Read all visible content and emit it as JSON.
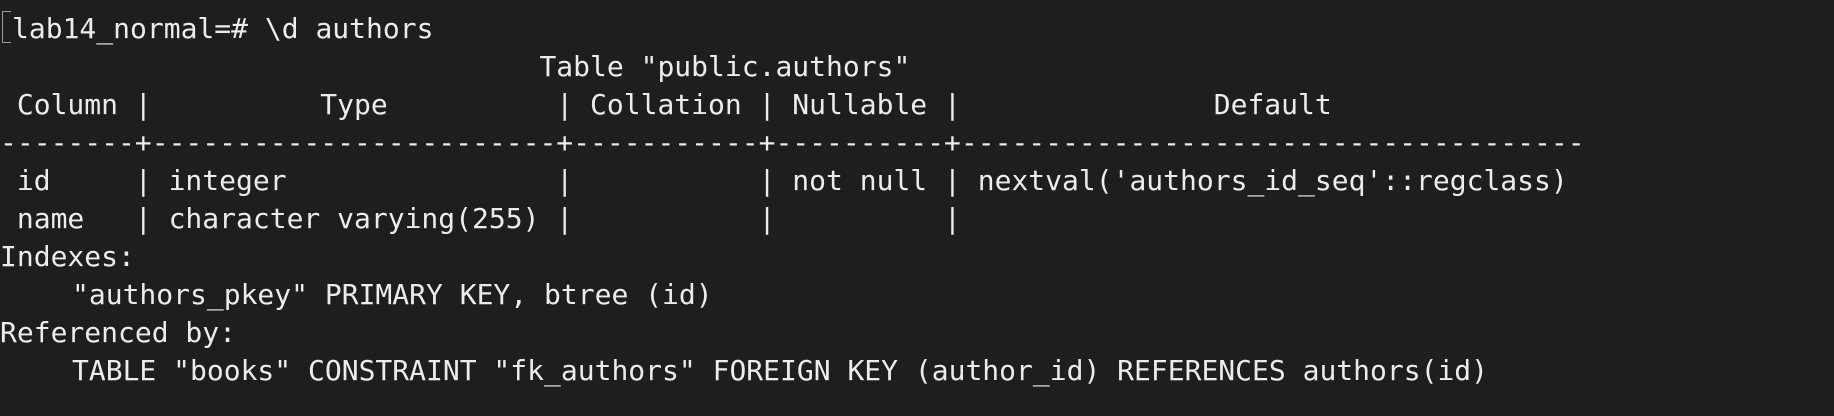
{
  "terminal": {
    "prompt": "lab14_normal=# ",
    "command": "\\d authors",
    "table_title": "                                Table \"public.authors\"",
    "header_row": " Column |          Type          | Collation | Nullable |               Default",
    "separator_row": "--------+------------------------+-----------+----------+-------------------------------------",
    "rows": [
      " id     | integer                |           | not null | nextval('authors_id_seq'::regclass)",
      " name   | character varying(255) |           |          |"
    ],
    "indexes_label": "Indexes:",
    "index_entry": "\"authors_pkey\" PRIMARY KEY, btree (id)",
    "referenced_label": "Referenced by:",
    "referenced_entry": "TABLE \"books\" CONSTRAINT \"fk_authors\" FOREIGN KEY (author_id) REFERENCES authors(id)"
  }
}
